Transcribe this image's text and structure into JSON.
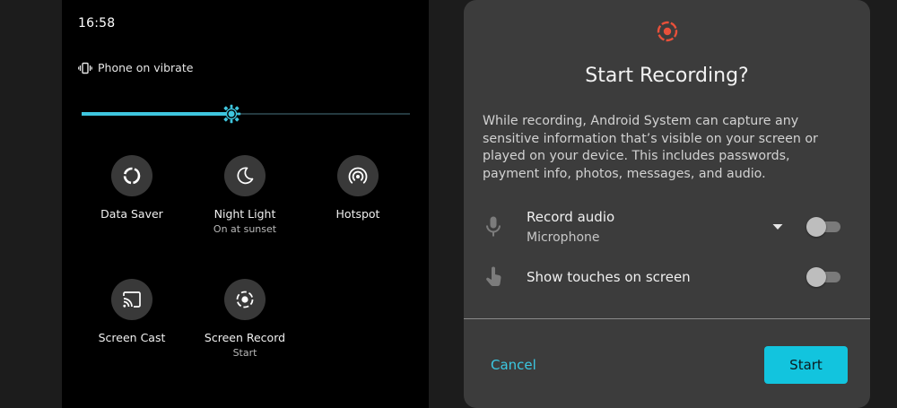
{
  "quick_settings": {
    "time": "16:58",
    "status_text": "Phone on vibrate",
    "brightness": {
      "level": 0.455
    },
    "tiles": [
      {
        "label": "Data Saver",
        "sub": "",
        "icon": "data-saver-icon"
      },
      {
        "label": "Night Light",
        "sub": "On at sunset",
        "icon": "night-light-icon"
      },
      {
        "label": "Hotspot",
        "sub": "",
        "icon": "hotspot-icon"
      },
      {
        "label": "Screen Cast",
        "sub": "",
        "icon": "screen-cast-icon"
      },
      {
        "label": "Screen Record",
        "sub": "Start",
        "icon": "screen-record-icon"
      }
    ]
  },
  "dialog": {
    "title": "Start Recording?",
    "body": "While recording, Android System can capture any sensitive information that’s visible on your screen or played on your device. This includes passwords, payment info, photos, messages, and audio.",
    "options": {
      "record_audio": {
        "label": "Record audio",
        "source": "Microphone",
        "enabled": false
      },
      "show_touches": {
        "label": "Show touches on screen",
        "enabled": false
      }
    },
    "cancel_label": "Cancel",
    "start_label": "Start"
  },
  "colors": {
    "accent": "#3fc6de",
    "record_red": "#e8503a",
    "start_button": "#12c4de"
  }
}
